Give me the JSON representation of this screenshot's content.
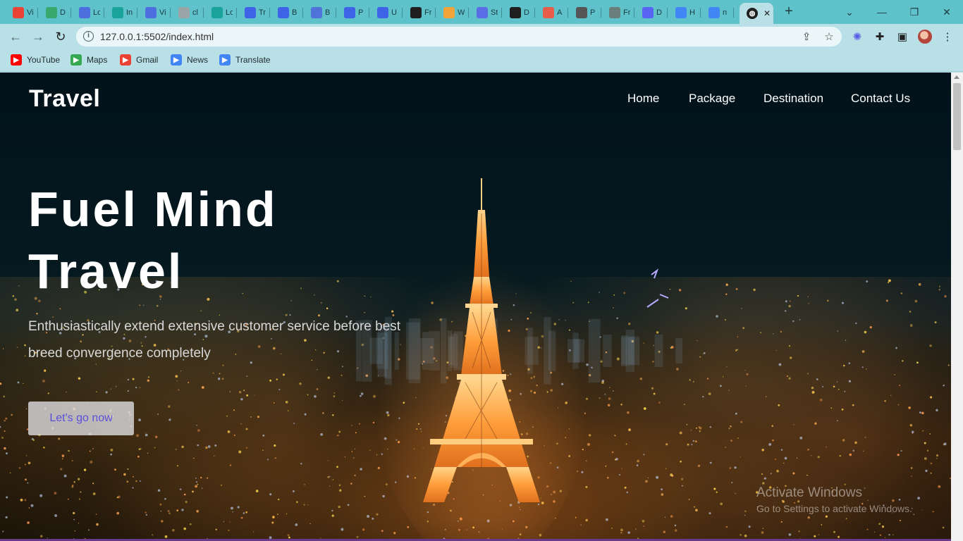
{
  "browser": {
    "tabs": [
      {
        "title": "Vi",
        "icon": "gmail-icon",
        "color": "#ea4335"
      },
      {
        "title": "D",
        "icon": "globe-green-icon",
        "color": "#3aa76d"
      },
      {
        "title": "Lo",
        "icon": "infinity-icon",
        "color": "#4d6fe0"
      },
      {
        "title": "In",
        "icon": "diamond-icon",
        "color": "#1aa39a"
      },
      {
        "title": "Vi",
        "icon": "infinity-icon",
        "color": "#4d6fe0"
      },
      {
        "title": "cl",
        "icon": "grey-globe-icon",
        "color": "#9aa5a8"
      },
      {
        "title": "Lo",
        "icon": "diamond-icon",
        "color": "#1aa39a"
      },
      {
        "title": "Tr",
        "icon": "c-logo-icon",
        "color": "#3f63e6"
      },
      {
        "title": "B",
        "icon": "c-logo-icon",
        "color": "#3f63e6"
      },
      {
        "title": "B",
        "icon": "printer-icon",
        "color": "#4f73d8"
      },
      {
        "title": "P",
        "icon": "c-logo-icon",
        "color": "#3f63e6"
      },
      {
        "title": "U",
        "icon": "c-logo-icon",
        "color": "#3f63e6"
      },
      {
        "title": "Fr",
        "icon": "github-icon",
        "color": "#1f1f1f"
      },
      {
        "title": "W",
        "icon": "cloud-icon",
        "color": "#f2a33a"
      },
      {
        "title": "St",
        "icon": "stackblitz-icon",
        "color": "#5b6ee8"
      },
      {
        "title": "D",
        "icon": "globe-icon",
        "color": "#1f1f1f"
      },
      {
        "title": "A",
        "icon": "rainbow-icon",
        "color": "#e85c4a"
      },
      {
        "title": "P",
        "icon": "feather-icon",
        "color": "#555555"
      },
      {
        "title": "Fr",
        "icon": "openai-icon",
        "color": "#6a7f7b"
      },
      {
        "title": "D",
        "icon": "discord-icon",
        "color": "#5865f2"
      },
      {
        "title": "H",
        "icon": "google-icon",
        "color": "#4285f4"
      },
      {
        "title": "n",
        "icon": "google-icon",
        "color": "#4285f4"
      }
    ],
    "active_tab_icon": "globe-icon",
    "active_tab_close": "✕",
    "new_tab": "+",
    "url": "127.0.0.1:5502/index.html",
    "bookmarks": [
      {
        "label": "YouTube",
        "icon": "youtube-icon",
        "color": "#ff0000"
      },
      {
        "label": "Maps",
        "icon": "maps-icon",
        "color": "#34a853"
      },
      {
        "label": "Gmail",
        "icon": "gmail-icon",
        "color": "#ea4335"
      },
      {
        "label": "News",
        "icon": "news-icon",
        "color": "#4285f4"
      },
      {
        "label": "Translate",
        "icon": "translate-icon",
        "color": "#4285f4"
      }
    ]
  },
  "site": {
    "logo": "Travel",
    "nav": [
      "Home",
      "Package",
      "Destination",
      "Contact Us"
    ],
    "hero": {
      "title_line1": "Fuel Mind",
      "title_line2": "Travel",
      "text": "Enthusiastically extend extensive customer service before best breed convergence completely",
      "button": "Let's go now"
    },
    "accent_color": "#5a4fd8"
  },
  "os_watermark": {
    "line1": "Activate Windows",
    "line2": "Go to Settings to activate Windows."
  }
}
